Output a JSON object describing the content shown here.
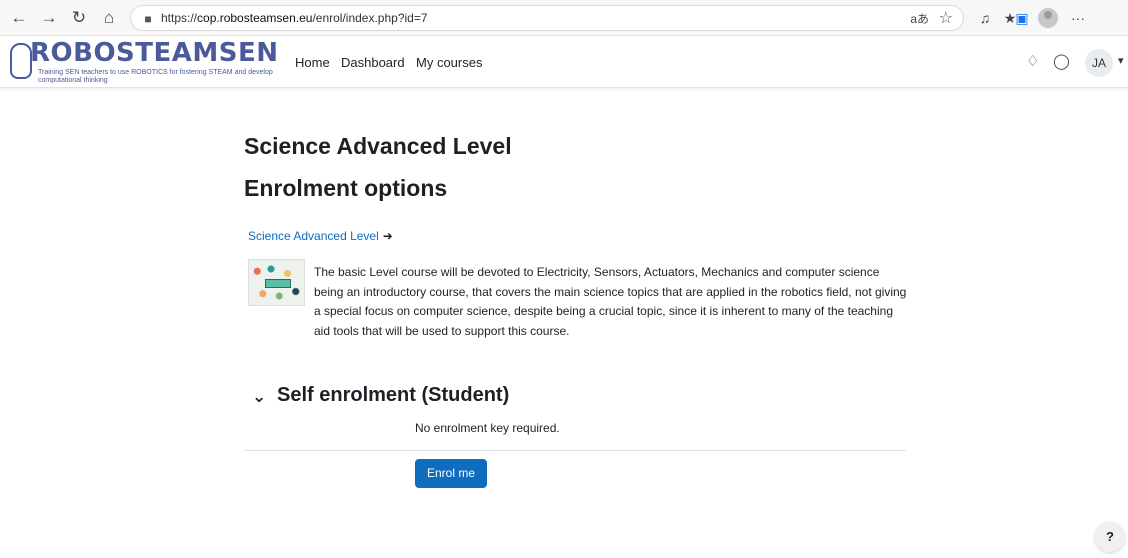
{
  "browser": {
    "url_prefix": "https://",
    "url_host": "cop.robosteamsen.eu",
    "url_path": "/enrol/index.php?id=7",
    "read_aloud": "aあ",
    "more": "···"
  },
  "site": {
    "logo_title": "ROBOSTEAMSEN",
    "logo_subtitle": "Training SEN teachers to use ROBOTICS for fostering STEAM and develop computational thinking",
    "nav": [
      "Home",
      "Dashboard",
      "My courses"
    ],
    "user_initials": "JA"
  },
  "page": {
    "course_title": "Science Advanced Level",
    "enrol_heading": "Enrolment options",
    "course_link": "Science Advanced Level",
    "course_summary": "The basic Level course will be devoted to Electricity, Sensors, Actuators, Mechanics and computer science being an introductory course, that covers the main science topics that are applied in the robotics field, not giving a special focus on computer science, despite being a crucial topic, since it is inherent to many of the teaching aid tools that will be used to support this course.",
    "section_title": "Self enrolment (Student)",
    "no_key_text": "No enrolment key required.",
    "enrol_button": "Enrol me",
    "help_label": "?"
  },
  "icons": {
    "back": "back-arrow-icon",
    "forward": "forward-arrow-icon",
    "reload": "reload-icon",
    "home": "home-icon",
    "lock": "lock-icon",
    "favorite": "star-icon",
    "notifications": "bell-icon",
    "messages": "chat-icon",
    "enter": "sign-in-icon"
  },
  "colors": {
    "link": "#0f6cbf",
    "primary_button": "#0f6cbf",
    "logo": "#4a5a9a"
  }
}
